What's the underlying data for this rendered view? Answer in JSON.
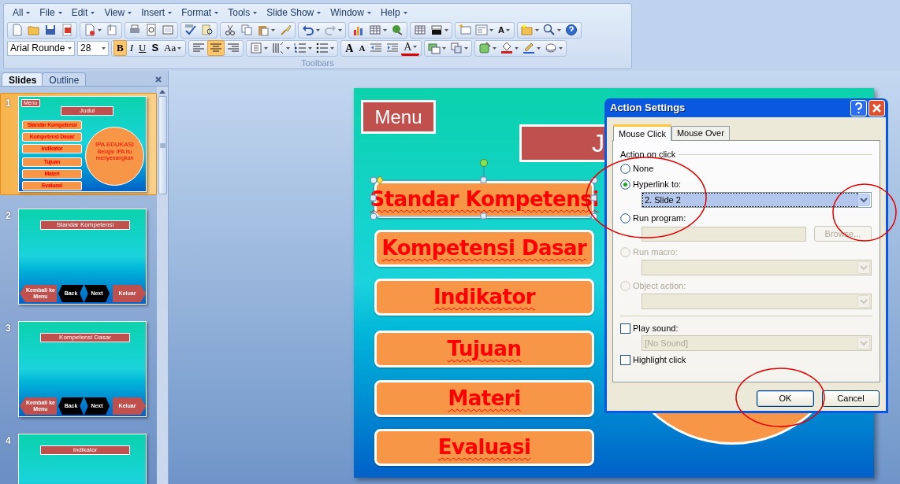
{
  "menu_bar": [
    "All",
    "File",
    "Edit",
    "View",
    "Insert",
    "Format",
    "Tools",
    "Slide Show",
    "Window",
    "Help"
  ],
  "toolbar": {
    "font": "Arial Rounde",
    "size": "28",
    "format_buttons": [
      {
        "label": "B",
        "selected": true
      },
      {
        "label": "I",
        "selected": false
      },
      {
        "label": "U",
        "selected": false
      },
      {
        "label": "S",
        "selected": false
      },
      {
        "label": "Aa",
        "selected": false
      }
    ],
    "align_buttons": [
      {
        "selected": false
      },
      {
        "selected": true
      },
      {
        "selected": false
      }
    ],
    "textbox_label": "A",
    "grow_label": "A",
    "shrink_label": "A",
    "font_color_label": "A",
    "group_label": "Toolbars"
  },
  "slides_pane": {
    "tabs": [
      {
        "label": "Slides",
        "selected": true
      },
      {
        "label": "Outline",
        "selected": false
      }
    ],
    "thumbnails": [
      {
        "number": "1",
        "selected": true,
        "kind": "menu",
        "menu": "Menu",
        "title": "Judul",
        "items": [
          "Standar Kompetensi",
          "Kompetensi Dasar",
          "Indikator",
          "Tujuan",
          "Materi",
          "Evaluasi"
        ],
        "circle_title": "IPA EDUKASI",
        "circle_subtitle": "Belajar IPA itu menyenangkan"
      },
      {
        "number": "2",
        "selected": false,
        "kind": "content",
        "title": "Standar Kompetensi",
        "nav": [
          "Kembali ke Menu",
          "Back",
          "Next",
          "Keluar"
        ]
      },
      {
        "number": "3",
        "selected": false,
        "kind": "content",
        "title": "Kompetensi Dasar",
        "nav": [
          "Kembali ke Menu",
          "Back",
          "Next",
          "Keluar"
        ]
      },
      {
        "number": "4",
        "selected": false,
        "kind": "content",
        "title": "Indikator"
      }
    ]
  },
  "slide": {
    "menu": "Menu",
    "title": "J",
    "items": [
      {
        "label": "Standar Kompetensi",
        "selected": true
      },
      {
        "label": "Kompetensi Dasar",
        "selected": false
      },
      {
        "label": "Indikator",
        "selected": false
      },
      {
        "label": "Tujuan",
        "selected": false
      },
      {
        "label": "Materi",
        "selected": false
      },
      {
        "label": "Evaluasi",
        "selected": false
      }
    ]
  },
  "dialog": {
    "title": "Action Settings",
    "tabs": [
      {
        "label": "Mouse Click",
        "selected": true
      },
      {
        "label": "Mouse Over",
        "selected": false
      }
    ],
    "section": "Action on click",
    "options": [
      {
        "label": "None",
        "selected": false,
        "disabled": false
      },
      {
        "label": "Hyperlink to:",
        "selected": true,
        "disabled": false,
        "field": {
          "kind": "dropdown",
          "value": "2. Slide 2",
          "disabled": false
        }
      },
      {
        "label": "Run program:",
        "selected": false,
        "disabled": false,
        "field": {
          "kind": "text",
          "disabled": true
        },
        "button": "Browse..."
      },
      {
        "label": "Run macro:",
        "selected": false,
        "disabled": true,
        "field": {
          "kind": "dropdown",
          "disabled": true
        }
      },
      {
        "label": "Object action:",
        "selected": false,
        "disabled": true,
        "field": {
          "kind": "dropdown",
          "disabled": true
        }
      }
    ],
    "play_sound": {
      "label": "Play sound:",
      "checked": false,
      "value": "[No Sound]"
    },
    "highlight": {
      "label": "Highlight click",
      "checked": false
    },
    "buttons": [
      {
        "label": "OK",
        "default": true
      },
      {
        "label": "Cancel",
        "default": false
      }
    ]
  }
}
